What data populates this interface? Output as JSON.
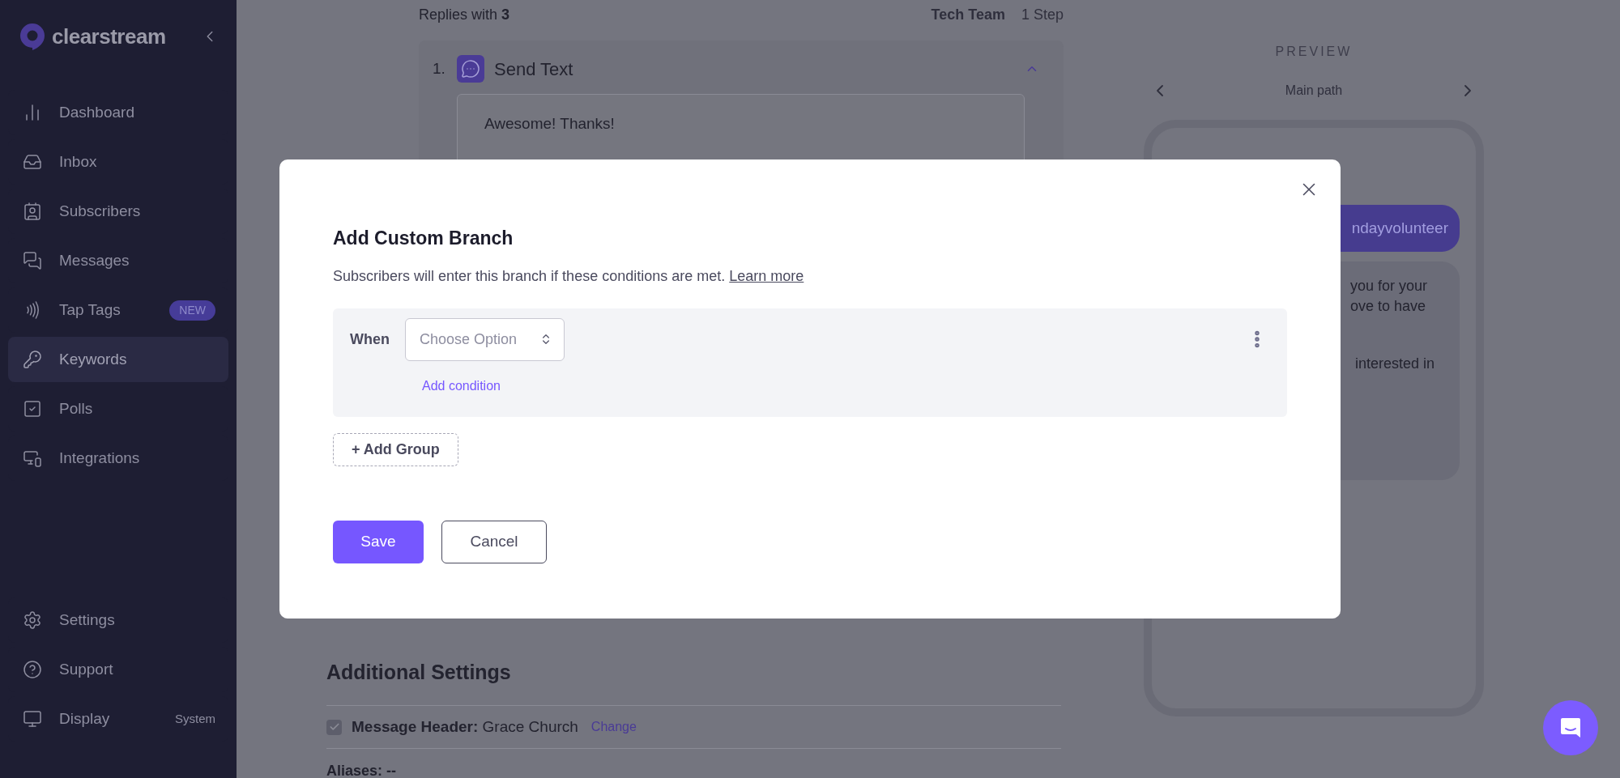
{
  "sidebar": {
    "brand": "clearstream",
    "items": [
      {
        "label": "Dashboard",
        "selected": false
      },
      {
        "label": "Inbox",
        "selected": false
      },
      {
        "label": "Subscribers",
        "selected": false
      },
      {
        "label": "Messages",
        "selected": false
      },
      {
        "label": "Tap Tags",
        "selected": false,
        "badge": "NEW"
      },
      {
        "label": "Keywords",
        "selected": true
      },
      {
        "label": "Polls",
        "selected": false
      },
      {
        "label": "Integrations",
        "selected": false
      }
    ],
    "footer_items": [
      {
        "label": "Settings"
      },
      {
        "label": "Support"
      },
      {
        "label": "Display",
        "value": "System"
      }
    ]
  },
  "flow": {
    "replies": "Replies with **3**",
    "team": "Tech Team",
    "steps": "1 Step"
  },
  "step": {
    "number": "1.",
    "title": "Send Text",
    "expanded": true,
    "message": "Awesome! Thanks!"
  },
  "additional_settings": {
    "title": "Additional Settings",
    "message_header": {
      "checked": true,
      "text": "**Message Header:** Grace Church",
      "link": "Change"
    },
    "aliases": "Aliases: --"
  },
  "preview": {
    "title": "PREVIEW",
    "path": "Main path",
    "outgoing": "ndayvolunteer",
    "incoming": [
      "you for your",
      "ove to have",
      "interested in"
    ]
  },
  "modal": {
    "title": "Add Custom Branch",
    "description": "Subscribers will enter this branch if these conditions are met.",
    "link": "Learn more",
    "group": {
      "when": "When",
      "select_placeholder": "Choose Option",
      "add_condition": "Add condition"
    },
    "add_group": "+ Add Group",
    "save": "Save",
    "cancel": "Cancel"
  }
}
